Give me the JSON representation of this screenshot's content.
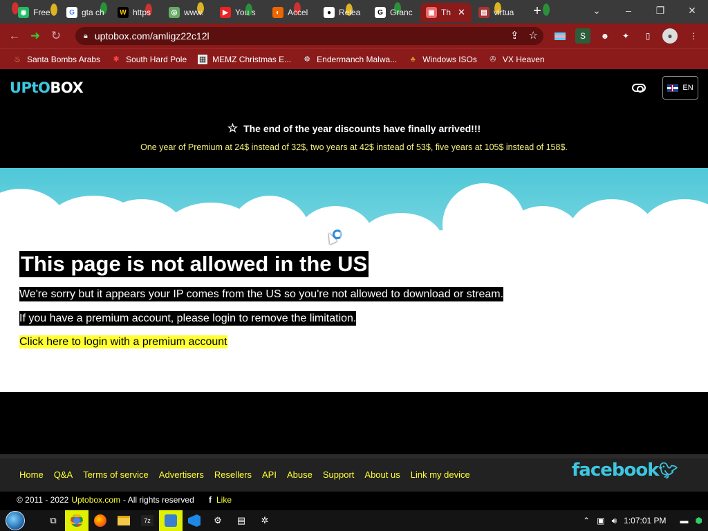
{
  "browser": {
    "tabs": [
      {
        "label": "Free",
        "icon": "globe-icon"
      },
      {
        "label": "gta ch",
        "icon": "google-icon"
      },
      {
        "label": "https",
        "icon": "w-icon"
      },
      {
        "label": "www.",
        "icon": "globe-icon"
      },
      {
        "label": "You s",
        "icon": "youtube-icon"
      },
      {
        "label": "Accel",
        "icon": "accel-icon"
      },
      {
        "label": "Relea",
        "icon": "github-icon"
      },
      {
        "label": "Granc",
        "icon": "g-icon"
      },
      {
        "label": "Th",
        "icon": "page-icon",
        "active": true
      },
      {
        "label": "virtua",
        "icon": "chart-icon"
      }
    ],
    "url": "uptobox.com/amligz22c12l",
    "bookmarks": [
      {
        "label": "Santa Bombs Arabs",
        "icon": "flame-icon"
      },
      {
        "label": "South Hard Pole",
        "icon": "star-icon"
      },
      {
        "label": "MEMZ Christmas E...",
        "icon": "page-icon"
      },
      {
        "label": "Endermanch Malwa...",
        "icon": "cat-icon"
      },
      {
        "label": "Windows ISOs",
        "icon": "tree-icon"
      },
      {
        "label": "VX Heaven",
        "icon": "bug-icon"
      }
    ]
  },
  "site": {
    "logo_a": "UPtO",
    "logo_b": "BOX",
    "lang": "EN",
    "promo_title": "The end of the year discounts have finally arrived!!!",
    "promo_text": "One year of Premium at 24$ instead of 32$, two years at 42$ instead of 53$, five years at 105$ instead of 158$.",
    "heading": "This page is not allowed in the US",
    "line1": "We're sorry but it appears your IP comes from the US so you're not allowed to download or stream.",
    "line2": "If you have a premium account, please login to remove the limitation.",
    "login_link": "Click here to login with a premium account",
    "footer_links": [
      "Home",
      "Q&A",
      "Terms of service",
      "Advertisers",
      "Resellers",
      "API",
      "Abuse",
      "Support",
      "About us",
      "Link my device"
    ],
    "social": "facebook",
    "copyright_prefix": "© 2011 - 2022",
    "copyright_site": "Uptobox.com",
    "copyright_suffix": "- All rights reserved",
    "like": "Like"
  },
  "taskbar": {
    "time": "1:07:01 PM"
  },
  "colors": {
    "accent": "#3ec6e0",
    "link_yellow": "#ffff33",
    "browser_red": "#8b1a1a"
  }
}
